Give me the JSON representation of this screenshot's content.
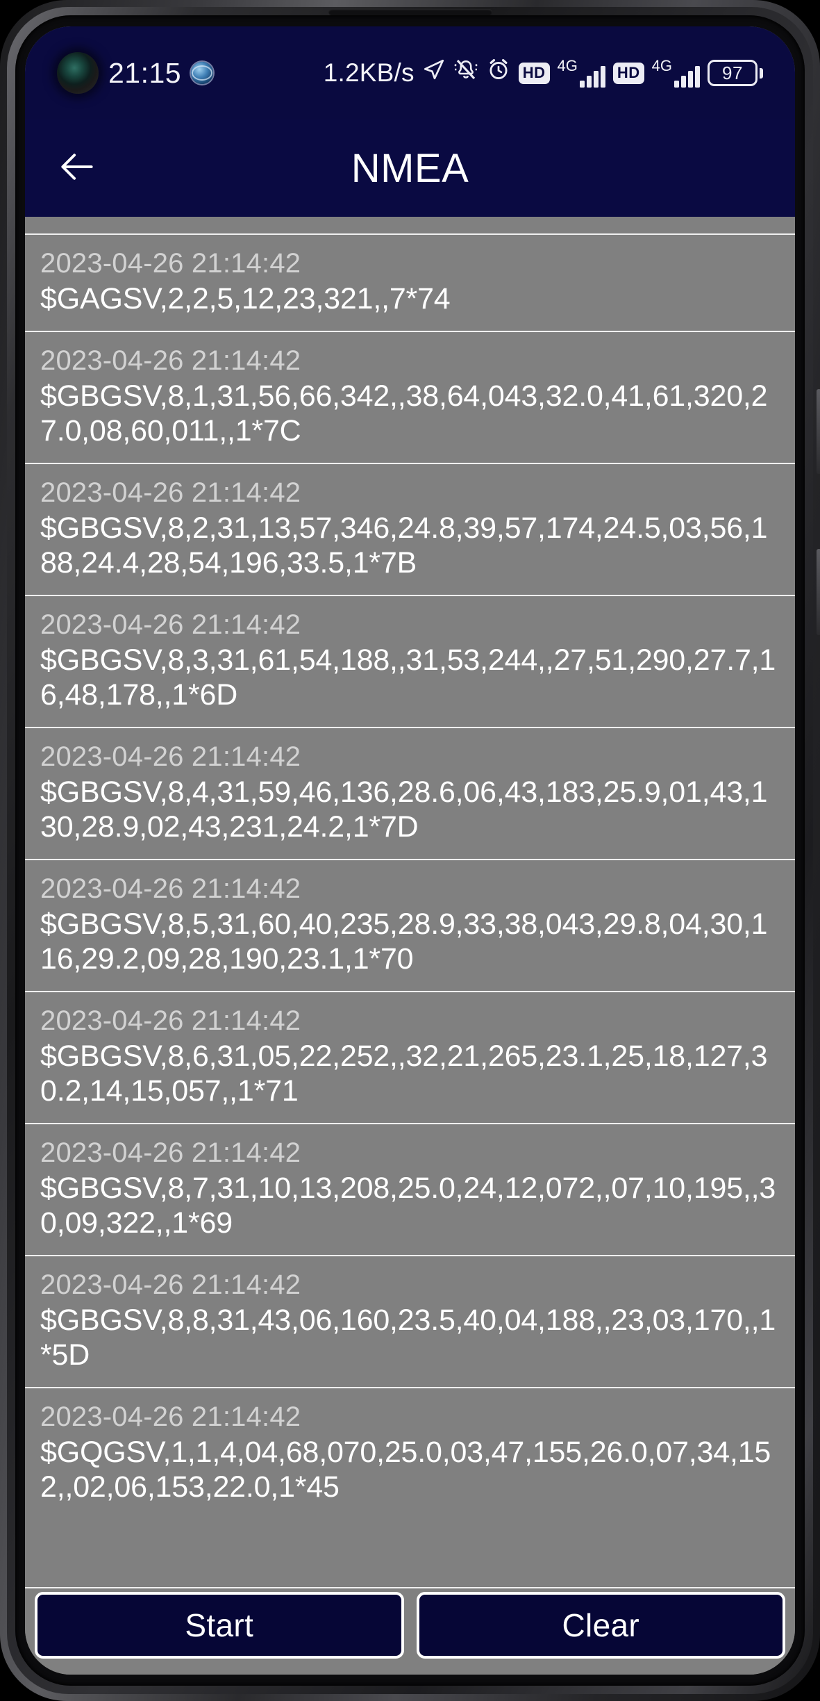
{
  "status_bar": {
    "time": "21:15",
    "data_rate": "1.2KB/s",
    "battery_percent": "97",
    "network_label_1": "4G",
    "network_label_2": "4G",
    "hd_badge_1": "HD",
    "hd_badge_2": "HD",
    "icons": {
      "camera": "front-camera-hole",
      "globe": "globe-icon",
      "location": "location-arrow-icon",
      "bell": "bell-muted-icon",
      "alarm": "alarm-clock-icon"
    }
  },
  "app_bar": {
    "title": "NMEA",
    "back_icon": "back-arrow-icon"
  },
  "log": {
    "rows": [
      {
        "time": "2023-04-26 21:14:42",
        "message": "$GAGSV,2,2,5,12,23,321,,7*74"
      },
      {
        "time": "2023-04-26 21:14:42",
        "message": "$GBGSV,8,1,31,56,66,342,,38,64,043,32.0,41,61,320,27.0,08,60,011,,1*7C"
      },
      {
        "time": "2023-04-26 21:14:42",
        "message": "$GBGSV,8,2,31,13,57,346,24.8,39,57,174,24.5,03,56,188,24.4,28,54,196,33.5,1*7B"
      },
      {
        "time": "2023-04-26 21:14:42",
        "message": "$GBGSV,8,3,31,61,54,188,,31,53,244,,27,51,290,27.7,16,48,178,,1*6D"
      },
      {
        "time": "2023-04-26 21:14:42",
        "message": "$GBGSV,8,4,31,59,46,136,28.6,06,43,183,25.9,01,43,130,28.9,02,43,231,24.2,1*7D"
      },
      {
        "time": "2023-04-26 21:14:42",
        "message": "$GBGSV,8,5,31,60,40,235,28.9,33,38,043,29.8,04,30,116,29.2,09,28,190,23.1,1*70"
      },
      {
        "time": "2023-04-26 21:14:42",
        "message": "$GBGSV,8,6,31,05,22,252,,32,21,265,23.1,25,18,127,30.2,14,15,057,,1*71"
      },
      {
        "time": "2023-04-26 21:14:42",
        "message": "$GBGSV,8,7,31,10,13,208,25.0,24,12,072,,07,10,195,,30,09,322,,1*69"
      },
      {
        "time": "2023-04-26 21:14:42",
        "message": "$GBGSV,8,8,31,43,06,160,23.5,40,04,188,,23,03,170,,1*5D"
      },
      {
        "time": "2023-04-26 21:14:42",
        "message": "$GQGSV,1,1,4,04,68,070,25.0,03,47,155,26.0,07,34,152,,02,06,153,22.0,1*45"
      }
    ]
  },
  "footer": {
    "start_label": "Start",
    "clear_label": "Clear"
  },
  "colors": {
    "status_bar_bg": "#0a0a40",
    "app_bar_bg": "#0a0a42",
    "list_bg": "#808080",
    "button_bg": "#060636",
    "text_primary": "#ffffff",
    "text_secondary": "#d2d2d2"
  }
}
